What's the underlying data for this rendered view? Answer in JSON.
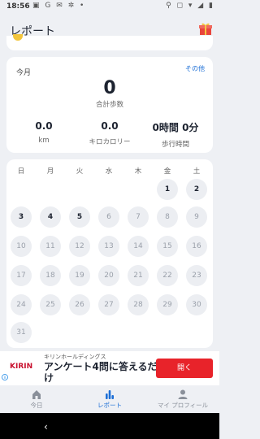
{
  "status_bar": {
    "time": "18:56",
    "left_icons": "▣ G ✉ ✲ •",
    "right_icons": "⚲ ◻ ▾ ◢ ▮"
  },
  "app_bar": {
    "title": "レポート"
  },
  "stats": {
    "month_label": "今月",
    "other_link": "その他",
    "total_steps_value": "0",
    "total_steps_label": "合計歩数",
    "distance_value": "0.0",
    "distance_label": "km",
    "calories_value": "0.0",
    "calories_label": "キロカロリー",
    "walk_time_value": "0時間 0分",
    "walk_time_label": "歩行時間"
  },
  "calendar": {
    "weekdays": [
      "日",
      "月",
      "火",
      "水",
      "木",
      "金",
      "土"
    ],
    "days": [
      "1",
      "2",
      "3",
      "4",
      "5",
      "6",
      "7",
      "8",
      "9",
      "10",
      "11",
      "12",
      "13",
      "14",
      "15",
      "16",
      "17",
      "18",
      "19",
      "20",
      "21",
      "22",
      "23",
      "24",
      "25",
      "26",
      "27",
      "28",
      "29",
      "30",
      "31"
    ]
  },
  "ad": {
    "brand": "KIRIN",
    "company": "キリンホールディングス",
    "headline": "アンケート4問に答えるだけ",
    "open_button": "開く"
  },
  "bottom_nav": {
    "today": "今日",
    "report": "レポート",
    "profile": "マイ プロフィール"
  },
  "colors": {
    "accent": "#1d6fd6",
    "background": "#eef0f4",
    "ad_button": "#e8232a"
  }
}
